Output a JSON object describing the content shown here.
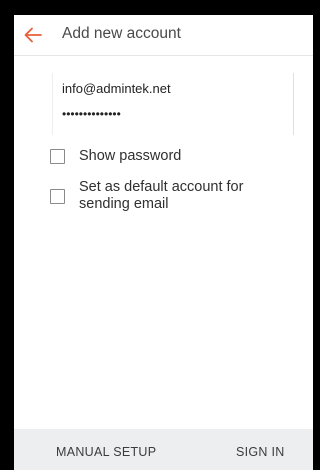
{
  "header": {
    "title": "Add new account",
    "back_icon": "arrow-left-icon",
    "accent_color": "#e8603a"
  },
  "form": {
    "email_value": "info@admintek.net",
    "password_mask": "••••••••••••••"
  },
  "options": {
    "show_password_label": "Show password",
    "show_password_checked": false,
    "default_account_line1": "Set as default account for",
    "default_account_line2": "sending email",
    "default_account_checked": false
  },
  "footer": {
    "manual_setup_label": "MANUAL SETUP",
    "sign_in_label": "SIGN IN"
  }
}
